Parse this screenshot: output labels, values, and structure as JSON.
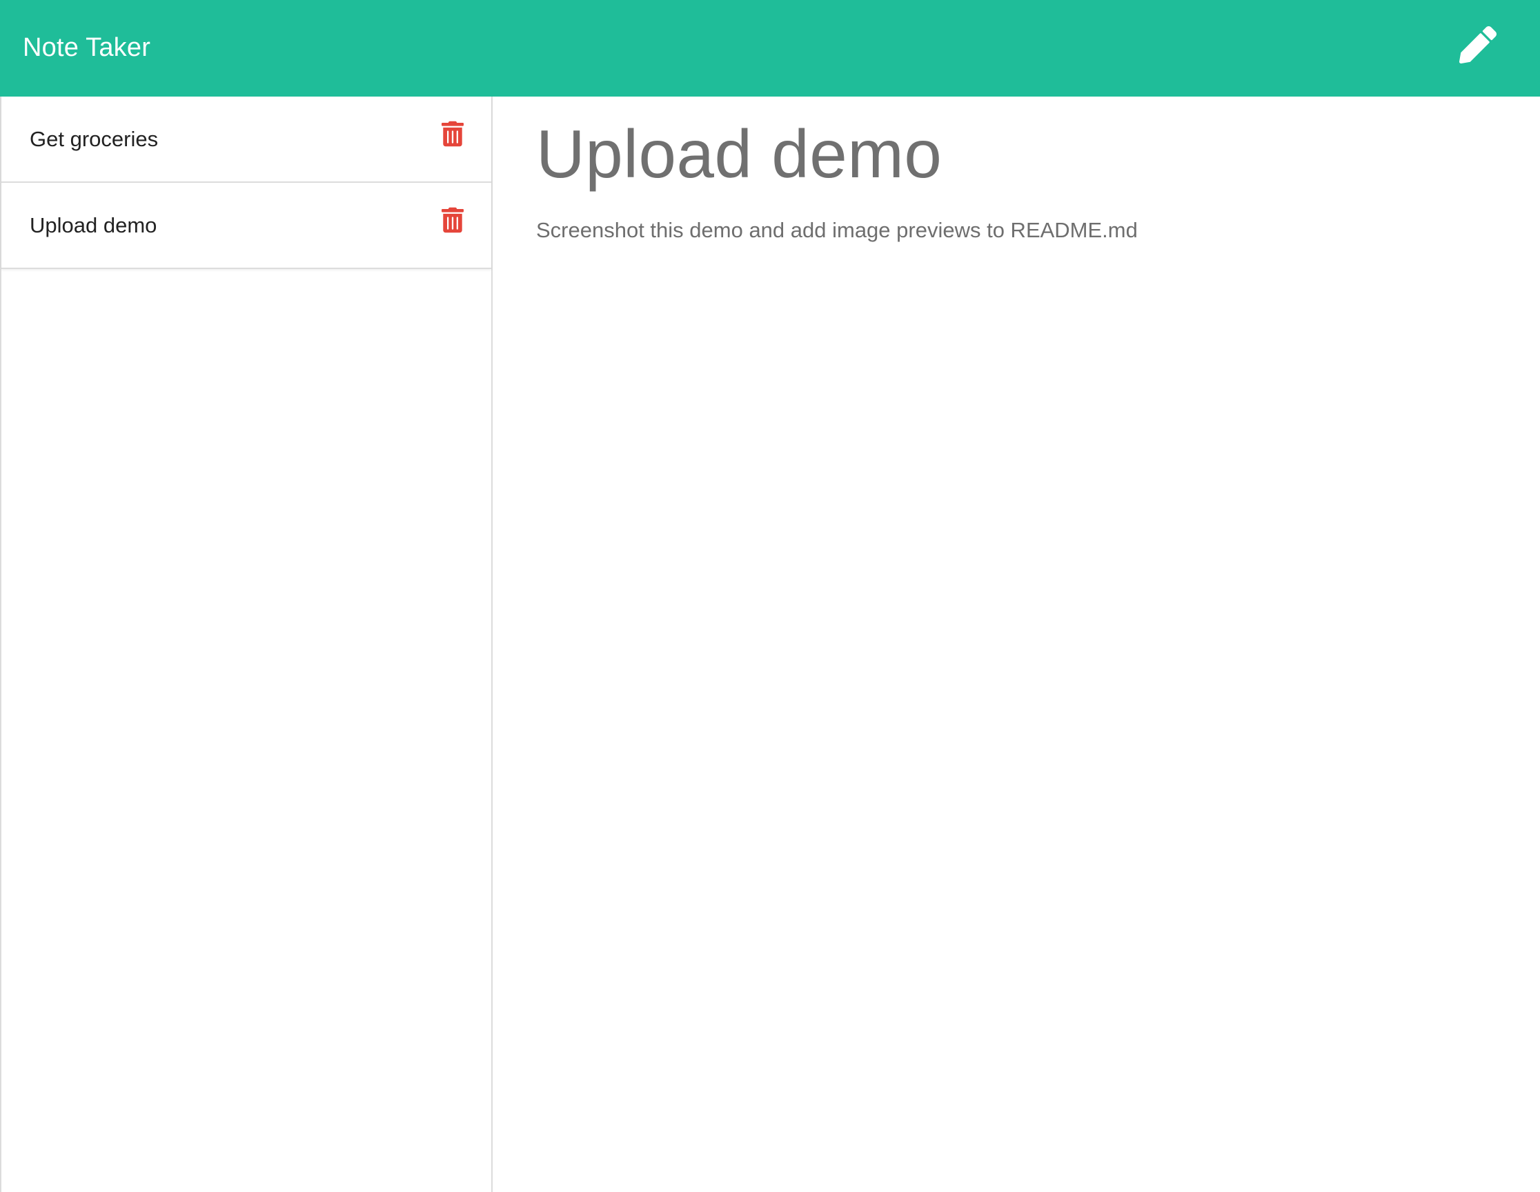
{
  "app": {
    "title": "Note Taker"
  },
  "header": {
    "new_note_icon": "pencil-icon",
    "background_color": "#1fbd99"
  },
  "sidebar": {
    "notes": [
      {
        "title": "Get groceries",
        "delete_icon": "trash-icon"
      },
      {
        "title": "Upload demo",
        "delete_icon": "trash-icon"
      }
    ],
    "delete_icon_color": "#e5453a"
  },
  "editor": {
    "title": "Upload demo",
    "body": "Screenshot this demo and add image previews to README.md"
  }
}
